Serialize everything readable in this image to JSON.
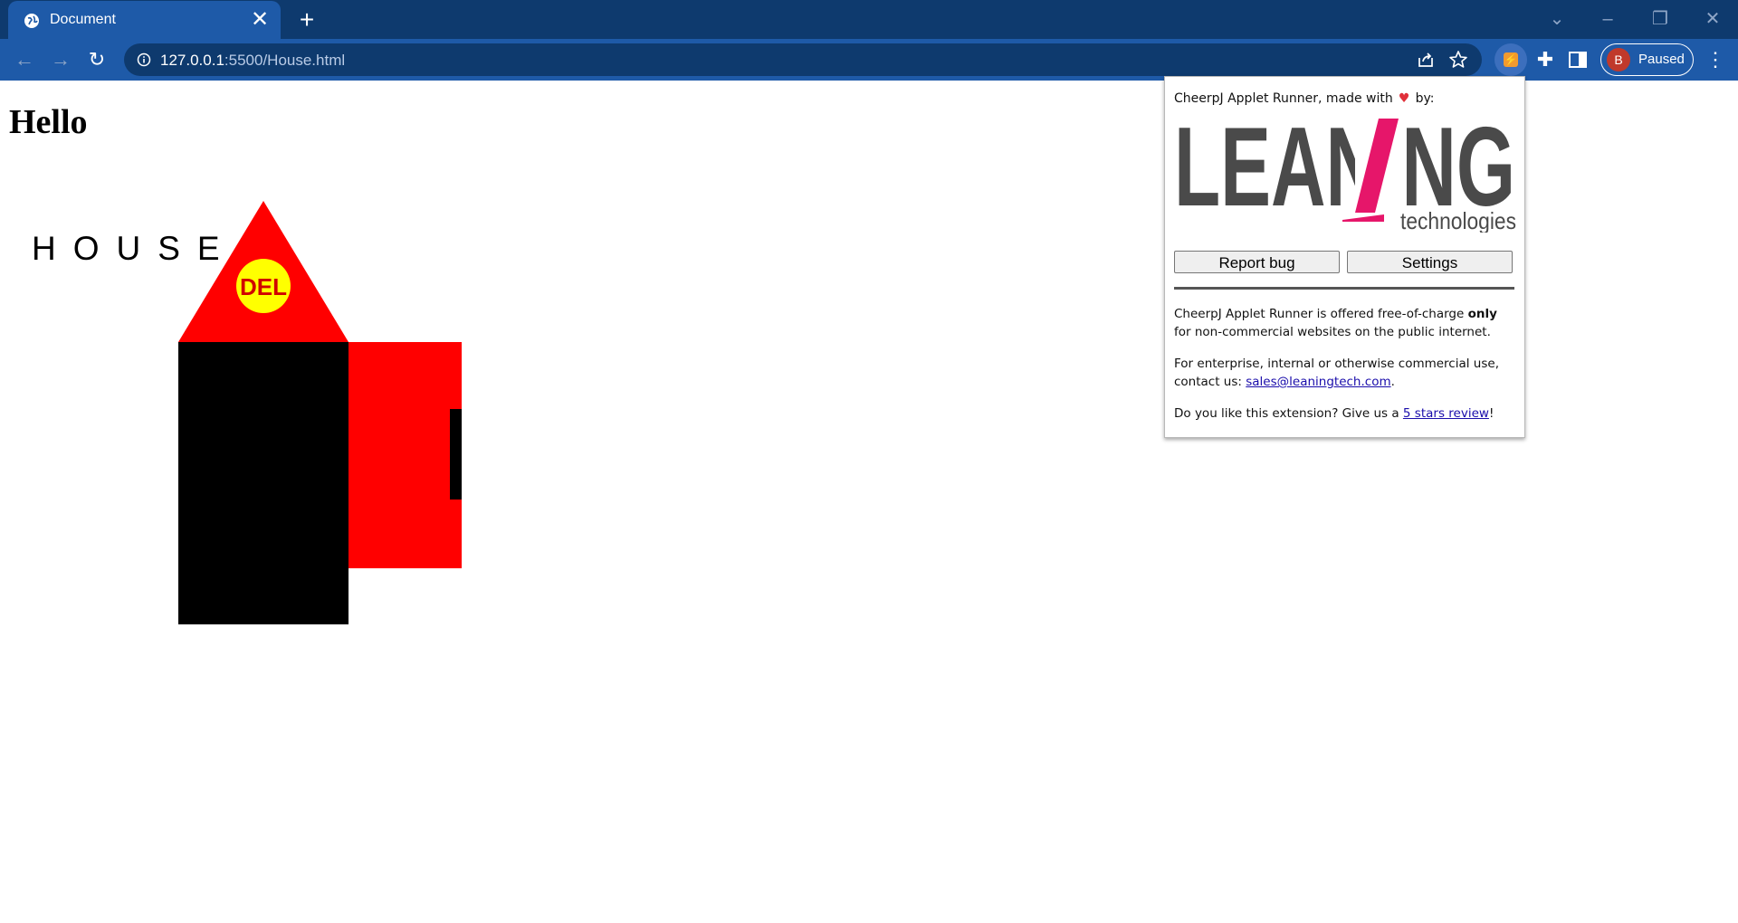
{
  "tab": {
    "title": "Document",
    "close": "✕"
  },
  "newtab": "+",
  "window_controls": {
    "dropdown": "⌄",
    "minimize": "–",
    "restore": "❐",
    "close": "✕"
  },
  "nav": {
    "back": "←",
    "forward": "→",
    "reload": "↻"
  },
  "address": {
    "host": "127.0.0.1",
    "rest": ":5500/House.html"
  },
  "profile": {
    "initial": "B",
    "label": "Paused"
  },
  "menu": "⋮",
  "page": {
    "heading": "Hello",
    "house_label": "HOUSE",
    "roof_badge": "DEL"
  },
  "popup": {
    "made_with_prefix": "CheerpJ Applet Runner, made with",
    "made_with_suffix": "by:",
    "heart": "♥",
    "logo_text": "LEANING",
    "logo_sub": "technologies",
    "report_bug": "Report bug",
    "settings": "Settings",
    "p1_prefix": "CheerpJ Applet Runner is offered free-of-charge ",
    "p1_bold": "only",
    "p1_suffix": " for non-commercial websites on the public internet.",
    "p2_prefix": "For enterprise, internal or otherwise commercial use, contact us: ",
    "p2_link": "sales@leaningtech.com",
    "p2_suffix": ".",
    "p3_prefix": "Do you like this extension? Give us a ",
    "p3_link": "5 stars review",
    "p3_suffix": "!"
  },
  "colors": {
    "chrome_dark": "#0e3a6e",
    "chrome_tab": "#1e5aa8",
    "house_red": "#ff0000",
    "badge_yellow": "#ffff00",
    "logo_gray": "#4a4a4a",
    "logo_pink": "#e6166a"
  }
}
